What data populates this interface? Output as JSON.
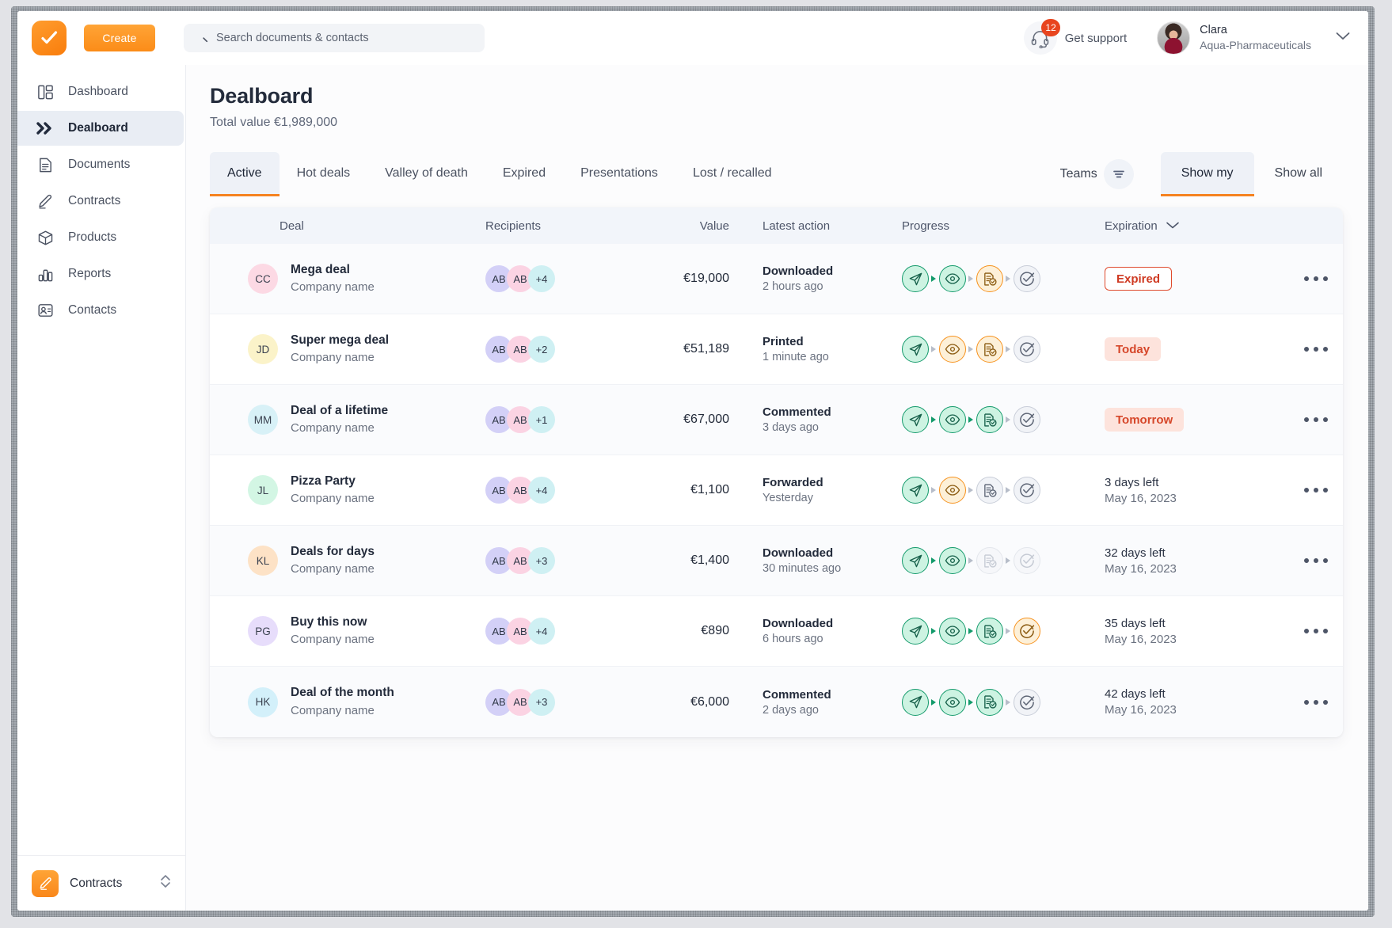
{
  "topbar": {
    "logo_icon": "check-badge-logo",
    "create_label": "Create",
    "search_placeholder": "Search documents & contacts",
    "search_value": "",
    "search_icon": "search-icon",
    "support_label": "Get support",
    "support_icon": "headset-icon",
    "support_badge": "12",
    "user_name": "Clara",
    "user_org": "Aqua-Pharmaceuticals",
    "user_chevron_icon": "chevron-down-icon"
  },
  "sidebar": {
    "items": [
      {
        "label": "Dashboard",
        "icon": "dashboard-icon",
        "active": false
      },
      {
        "label": "Dealboard",
        "icon": "double-chevron-icon",
        "active": true
      },
      {
        "label": "Documents",
        "icon": "document-icon",
        "active": false
      },
      {
        "label": "Contracts",
        "icon": "pen-icon",
        "active": false
      },
      {
        "label": "Products",
        "icon": "box-icon",
        "active": false
      },
      {
        "label": "Reports",
        "icon": "bar-chart-icon",
        "active": false
      },
      {
        "label": "Contacts",
        "icon": "contact-card-icon",
        "active": false
      }
    ],
    "bottom": {
      "label": "Contracts",
      "icon": "pen-tile-icon",
      "expander_icon": "up-down-chevron-icon"
    }
  },
  "main": {
    "title": "Dealboard",
    "subtitle": "Total value €1,989,000",
    "tabs": [
      {
        "label": "Active",
        "active": true
      },
      {
        "label": "Hot deals",
        "active": false
      },
      {
        "label": "Valley of death",
        "active": false
      },
      {
        "label": "Expired",
        "active": false
      },
      {
        "label": "Presentations",
        "active": false
      },
      {
        "label": "Lost / recalled",
        "active": false
      }
    ],
    "teams_label": "Teams",
    "filter_icon": "filter-icon",
    "segments": [
      {
        "label": "Show my",
        "active": true
      },
      {
        "label": "Show all",
        "active": false
      }
    ],
    "table": {
      "columns": [
        "Deal",
        "Recipients",
        "Value",
        "Latest action",
        "Progress",
        "Expiration"
      ],
      "sort_icon": "chevron-down-icon",
      "rows": [
        {
          "initials": "CC",
          "avatar_color": "#fcd9e4",
          "deal": "Mega deal",
          "company": "Company name",
          "recipients": [
            "AB",
            "AB"
          ],
          "recipients_more": "+4",
          "value": "€19,000",
          "action": "Downloaded",
          "action_time": "2 hours ago",
          "progress": [
            "green",
            "green",
            "orange",
            "grey"
          ],
          "expiration_type": "pill-expired",
          "expiration": "Expired",
          "expiration_sub": ""
        },
        {
          "initials": "JD",
          "avatar_color": "#fbf3c9",
          "deal": "Super mega deal",
          "company": "Company name",
          "recipients": [
            "AB",
            "AB"
          ],
          "recipients_more": "+2",
          "value": "€51,189",
          "action": "Printed",
          "action_time": "1 minute ago",
          "progress": [
            "green",
            "orange",
            "orange",
            "grey"
          ],
          "expiration_type": "pill-soft",
          "expiration": "Today",
          "expiration_sub": ""
        },
        {
          "initials": "MM",
          "avatar_color": "#d8f1f7",
          "deal": "Deal of a lifetime",
          "company": "Company name",
          "recipients": [
            "AB",
            "AB"
          ],
          "recipients_more": "+1",
          "value": "€67,000",
          "action": "Commented",
          "action_time": "3 days ago",
          "progress": [
            "green",
            "green",
            "green",
            "grey"
          ],
          "expiration_type": "pill-soft",
          "expiration": "Tomorrow",
          "expiration_sub": ""
        },
        {
          "initials": "JL",
          "avatar_color": "#d3f6e4",
          "deal": "Pizza Party",
          "company": "Company name",
          "recipients": [
            "AB",
            "AB"
          ],
          "recipients_more": "+4",
          "value": "€1,100",
          "action": "Forwarded",
          "action_time": "Yesterday",
          "progress": [
            "green",
            "orange",
            "grey",
            "grey"
          ],
          "expiration_type": "text",
          "expiration": "3 days left",
          "expiration_sub": "May 16, 2023"
        },
        {
          "initials": "KL",
          "avatar_color": "#fde2c6",
          "deal": "Deals for days",
          "company": "Company name",
          "recipients": [
            "AB",
            "AB"
          ],
          "recipients_more": "+3",
          "value": "€1,400",
          "action": "Downloaded",
          "action_time": "30 minutes ago",
          "progress": [
            "green",
            "green",
            "faded",
            "faded"
          ],
          "expiration_type": "text",
          "expiration": "32 days left",
          "expiration_sub": "May 16, 2023"
        },
        {
          "initials": "PG",
          "avatar_color": "#e7ddfb",
          "deal": "Buy this now",
          "company": "Company name",
          "recipients": [
            "AB",
            "AB"
          ],
          "recipients_more": "+4",
          "value": "€890",
          "action": "Downloaded",
          "action_time": "6 hours ago",
          "progress": [
            "green",
            "green",
            "green",
            "orange"
          ],
          "expiration_type": "text",
          "expiration": "35 days left",
          "expiration_sub": "May 16, 2023"
        },
        {
          "initials": "HK",
          "avatar_color": "#d3f0fa",
          "deal": "Deal of the month",
          "company": "Company name",
          "recipients": [
            "AB",
            "AB"
          ],
          "recipients_more": "+3",
          "value": "€6,000",
          "action": "Commented",
          "action_time": "2 days ago",
          "progress": [
            "green",
            "green",
            "green",
            "grey"
          ],
          "expiration_type": "text",
          "expiration": "42 days left",
          "expiration_sub": "May 16, 2023"
        }
      ],
      "row_menu_icon": "ellipsis-icon",
      "progress_icons": [
        "send-icon",
        "eye-icon",
        "document-check-icon",
        "check-circle-icon"
      ]
    }
  },
  "colors": {
    "accent": "#f58220",
    "green": "#139a6b",
    "orange": "#f6921e",
    "red": "#d6472a",
    "badge_red": "#e8451f"
  }
}
